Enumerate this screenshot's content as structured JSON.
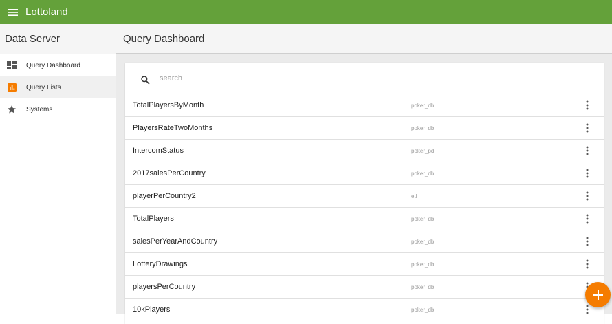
{
  "app": {
    "title": "Lottoland",
    "icon": "menu-icon"
  },
  "sidebar": {
    "title": "Data Server",
    "items": [
      {
        "label": "Query Dashboard",
        "icon": "dashboard-icon",
        "active": false
      },
      {
        "label": "Query Lists",
        "icon": "bar-chart-icon",
        "active": true
      },
      {
        "label": "Systems",
        "icon": "star-icon",
        "active": false
      }
    ]
  },
  "main": {
    "title": "Query Dashboard",
    "search": {
      "placeholder": "search",
      "value": ""
    },
    "rows": [
      {
        "name": "TotalPlayersByMonth",
        "db": "poker_db"
      },
      {
        "name": "PlayersRateTwoMonths",
        "db": "poker_db"
      },
      {
        "name": "IntercomStatus",
        "db": "poker_pd"
      },
      {
        "name": "2017salesPerCountry",
        "db": "poker_db"
      },
      {
        "name": "playerPerCountry2",
        "db": "etl"
      },
      {
        "name": "TotalPlayers",
        "db": "poker_db"
      },
      {
        "name": "salesPerYearAndCountry",
        "db": "poker_db"
      },
      {
        "name": "LotteryDrawings",
        "db": "poker_db"
      },
      {
        "name": "playersPerCountry",
        "db": "poker_db"
      },
      {
        "name": "10kPlayers",
        "db": "poker_db"
      }
    ]
  },
  "fab": {
    "icon": "plus-icon"
  },
  "colors": {
    "topbar": "#64a13a",
    "accent": "#f57c00",
    "background": "#ebebeb"
  }
}
